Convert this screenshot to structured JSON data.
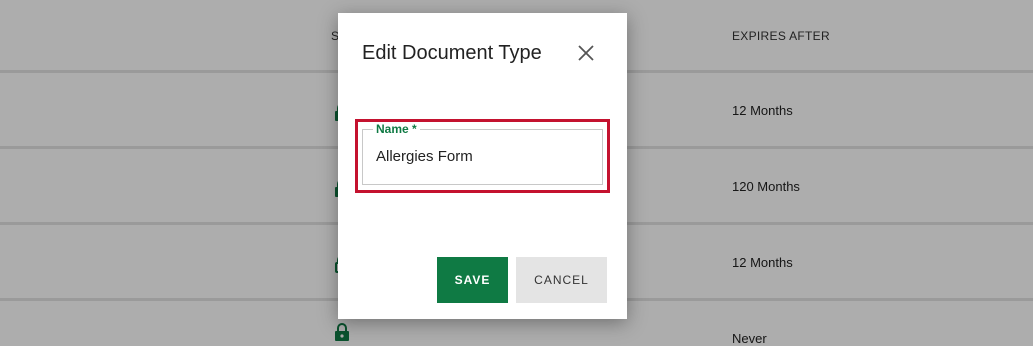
{
  "table": {
    "headers": {
      "status": "S",
      "expires_after": "EXPIRES AFTER"
    },
    "rows": [
      {
        "expires_after": "12 Months",
        "status_icon": "lock-icon"
      },
      {
        "expires_after": "120 Months",
        "status_icon": "lock-icon"
      },
      {
        "expires_after": "12 Months",
        "status_icon": "unlock-icon"
      },
      {
        "expires_after": "Never",
        "status_icon": "lock-icon"
      }
    ]
  },
  "modal": {
    "title": "Edit Document Type",
    "close_icon": "close-icon",
    "name_field": {
      "label": "Name *",
      "value": "Allergies Form"
    },
    "save_label": "SAVE",
    "cancel_label": "CANCEL"
  },
  "colors": {
    "accent_green": "#0f7a44",
    "highlight_red": "#c4122f",
    "overlay": "rgba(0,0,0,0.32)"
  }
}
